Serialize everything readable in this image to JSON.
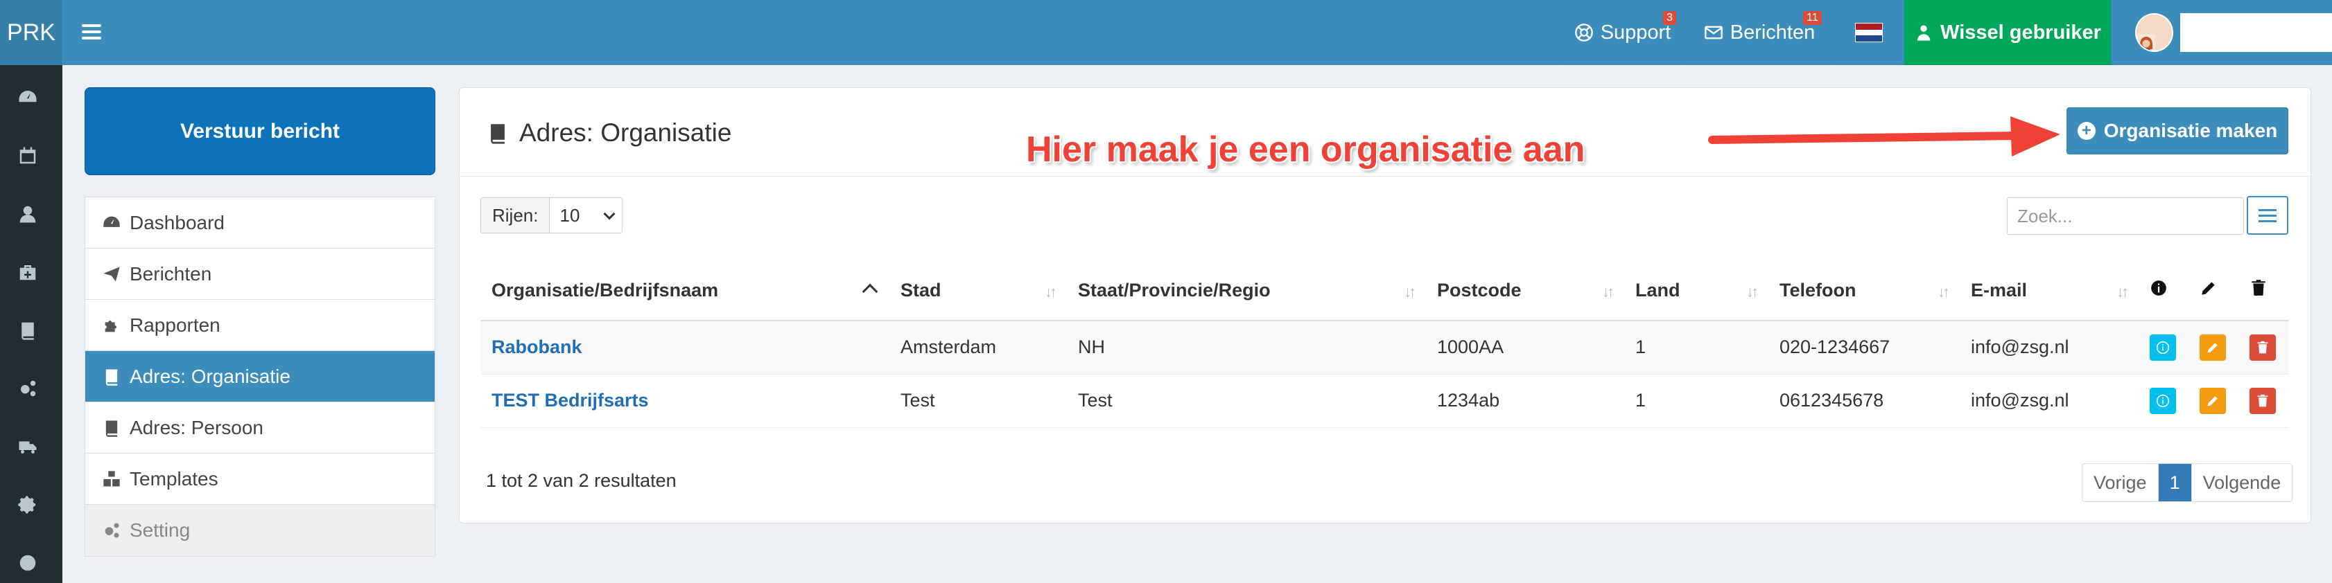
{
  "app": {
    "logo": "PRK"
  },
  "topbar": {
    "support_label": "Support",
    "support_badge": "3",
    "berichten_label": "Berichten",
    "berichten_badge": "11",
    "language_flag": "nl-flag",
    "switch_user_label": "Wissel gebruiker",
    "colors": {
      "bar": "#3c8dbc",
      "switch": "#00a65a",
      "badge": "#dd4b39"
    }
  },
  "rail_icons": [
    "dashboard-icon",
    "calendar-icon",
    "user-icon",
    "medkit-icon",
    "book-icon",
    "cogs-icon",
    "truck-icon",
    "gear-icon",
    "circle-icon"
  ],
  "sidebar": {
    "send_button": "Verstuur bericht",
    "items": [
      {
        "label": "Dashboard",
        "icon": "dashboard-icon"
      },
      {
        "label": "Berichten",
        "icon": "send-icon"
      },
      {
        "label": "Rapporten",
        "icon": "puzzle-icon"
      },
      {
        "label": "Adres: Organisatie",
        "icon": "book-icon",
        "active": true
      },
      {
        "label": "Adres: Persoon",
        "icon": "book-icon"
      },
      {
        "label": "Templates",
        "icon": "cubes-icon"
      },
      {
        "label": "Setting",
        "icon": "cogs-icon"
      }
    ]
  },
  "main": {
    "title": "Adres: Organisatie",
    "make_button": "Organisatie maken",
    "annotation": "Hier maak je een organisatie aan",
    "rows_label": "Rijen:",
    "rows_value": "10",
    "search_placeholder": "Zoek...",
    "columns": [
      "Organisatie/Bedrijfsnaam",
      "Stad",
      "Staat/Provincie/Regio",
      "Postcode",
      "Land",
      "Telefoon",
      "E-mail"
    ],
    "rows": [
      {
        "name": "Rabobank",
        "city": "Amsterdam",
        "region": "NH",
        "postcode": "1000AA",
        "country": "1",
        "phone": "020-1234667",
        "email": "info@zsg.nl"
      },
      {
        "name": "TEST Bedrijfsarts",
        "city": "Test",
        "region": "Test",
        "postcode": "1234ab",
        "country": "1",
        "phone": "0612345678",
        "email": "info@zsg.nl"
      }
    ],
    "result_text": "1 tot 2 van 2 resultaten",
    "pager": {
      "prev": "Vorige",
      "current": "1",
      "next": "Volgende"
    }
  }
}
